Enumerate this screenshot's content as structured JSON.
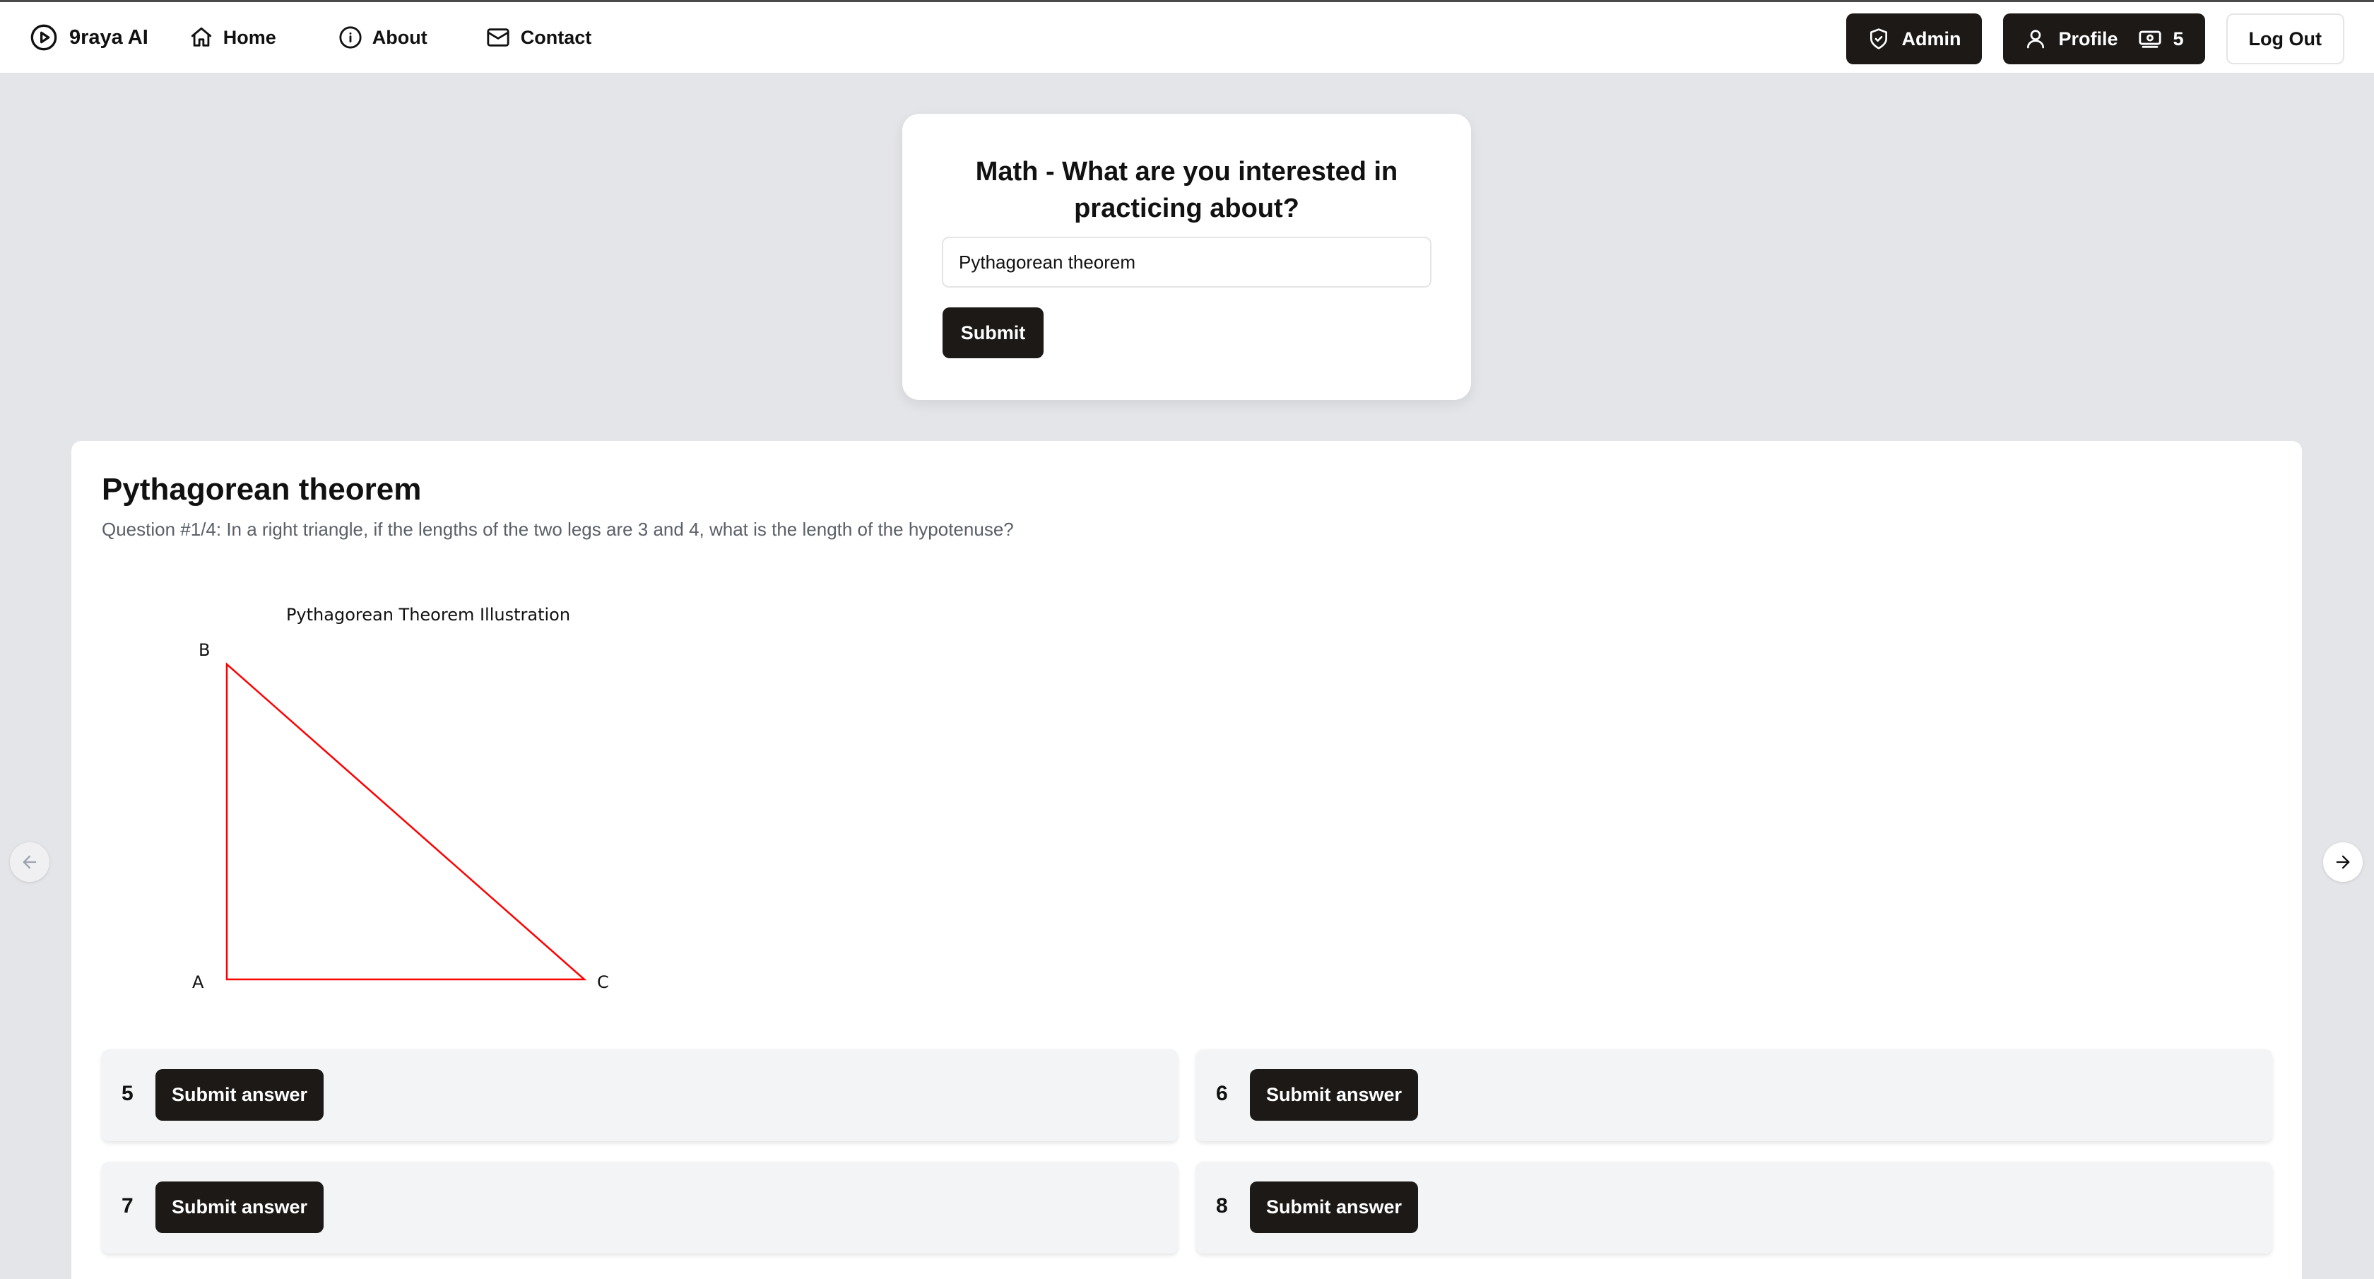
{
  "app": {
    "brand_name": "9raya AI",
    "icons": {
      "brand": "play-circle-icon"
    }
  },
  "nav": {
    "home_label": "Home",
    "about_label": "About",
    "contact_label": "Contact",
    "icons": {
      "home": "home-icon",
      "about": "info-icon",
      "contact": "mail-icon"
    }
  },
  "account": {
    "admin_label": "Admin",
    "profile_label": "Profile",
    "credits": "5",
    "logout_label": "Log Out",
    "icons": {
      "admin": "shield-icon",
      "profile": "user-icon",
      "credits": "banknote-icon"
    }
  },
  "topic_form": {
    "prompt": "Math - What are you interested in practicing about?",
    "input_value": "Pythagorean theorem",
    "submit_label": "Submit"
  },
  "question": {
    "title": "Pythagorean theorem",
    "text": "Question #1/4: In a right triangle, if the lengths of the two legs are 3 and 4, what is the length of the hypotenuse?",
    "figure": {
      "title": "Pythagorean Theorem Illustration",
      "vertex_labels": [
        "A",
        "B",
        "C"
      ],
      "stroke_color": "#ff0000"
    },
    "answers": [
      {
        "value": "5",
        "button_label": "Submit answer"
      },
      {
        "value": "6",
        "button_label": "Submit answer"
      },
      {
        "value": "7",
        "button_label": "Submit answer"
      },
      {
        "value": "8",
        "button_label": "Submit answer"
      }
    ]
  },
  "carousel": {
    "icons": {
      "prev": "arrow-left-icon",
      "next": "arrow-right-icon"
    }
  },
  "colors": {
    "background": "#e4e5e9",
    "primary_button": "#1c1917",
    "answer_box": "#f3f4f6",
    "triangle": "#ff0000"
  }
}
